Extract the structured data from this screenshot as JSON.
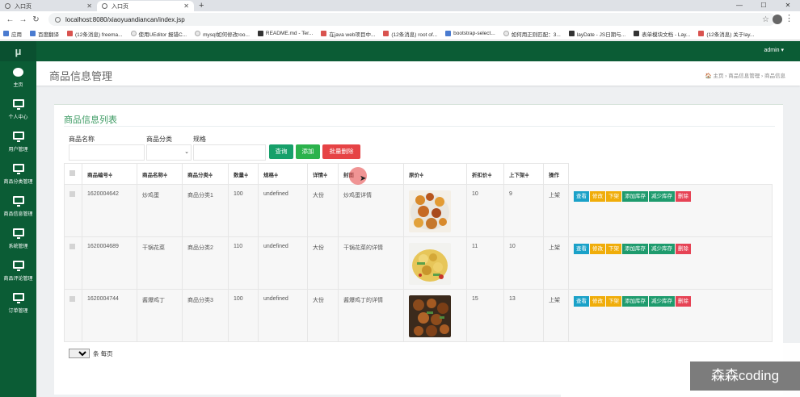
{
  "browser": {
    "tabs": [
      {
        "title": "入口页",
        "active": false
      },
      {
        "title": "入口页",
        "active": true
      }
    ],
    "url": "localhost:8080/xiaoyuandiancan/index.jsp",
    "bookmarks": [
      "应用",
      "百度翻译",
      "(12条消息) freema...",
      "使用UEditor 报错C...",
      "mysql如何修改roo...",
      "README.md - Ter...",
      "在java web项目中...",
      "(12条消息) root of...",
      "bootstrap-select...",
      "如何用正则匹配：3...",
      "layDate - JS日期与...",
      "表单模块文档 - Lay...",
      "(12条消息) 关于lay..."
    ]
  },
  "app": {
    "logo": "μ",
    "user": "admin ▾",
    "sidebar": [
      {
        "label": "主页",
        "icon": "palette-icon"
      },
      {
        "label": "个人中心",
        "icon": "monitor-icon"
      },
      {
        "label": "用户管理",
        "icon": "monitor-icon"
      },
      {
        "label": "商品分类管理",
        "icon": "monitor-icon"
      },
      {
        "label": "商品信息管理",
        "icon": "monitor-icon"
      },
      {
        "label": "系统管理",
        "icon": "monitor-icon"
      },
      {
        "label": "商品评论管理",
        "icon": "monitor-icon"
      },
      {
        "label": "订单管理",
        "icon": "monitor-icon"
      }
    ],
    "page_title": "商品信息管理",
    "breadcrumb": "🏠 主页 › 商品信息管理 › 商品信息"
  },
  "list": {
    "title": "商品信息列表",
    "filters": {
      "name_label": "商品名称",
      "category_label": "商品分类",
      "spec_label": "规格"
    },
    "buttons": {
      "search": "查询",
      "add": "添加",
      "batch_delete": "批量删除"
    },
    "columns": [
      "商品编号≑",
      "商品名称≑",
      "商品分类≑",
      "数量≑",
      "规格≑",
      "详情≑",
      "封面",
      "原价≑",
      "折扣价≑",
      "上下架≑",
      "操作"
    ],
    "rows": [
      {
        "id": "1620004642",
        "name": "炒鸡蛋",
        "category": "商品分类1",
        "qty": "100",
        "spec": "undefined",
        "size": "大份",
        "detail": "炒鸡蛋详情",
        "price": "10",
        "discount": "9",
        "status": "上架"
      },
      {
        "id": "1620004689",
        "name": "干锅花菜",
        "category": "商品分类2",
        "qty": "110",
        "spec": "undefined",
        "size": "大份",
        "detail": "干锅花菜的详情",
        "price": "11",
        "discount": "10",
        "status": "上架"
      },
      {
        "id": "1620004744",
        "name": "酱爆鸡丁",
        "category": "商品分类3",
        "qty": "100",
        "spec": "undefined",
        "size": "大份",
        "detail": "酱爆鸡丁的详情",
        "price": "15",
        "discount": "13",
        "status": "上架"
      }
    ],
    "actions": [
      "查看",
      "修改",
      "下架",
      "添加库存",
      "减少库存",
      "删除"
    ],
    "pager": {
      "page_size": "10",
      "suffix": "条 每页"
    }
  },
  "watermark": "森森coding"
}
